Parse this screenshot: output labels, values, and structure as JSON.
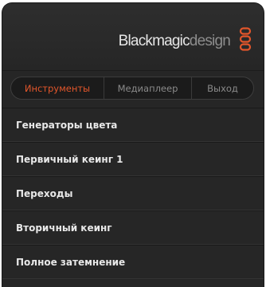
{
  "brand": {
    "name_bold": "Blackmagic",
    "name_light": "design",
    "logo_icon": "blackmagic-logo-icon",
    "accent_color": "#e2562b"
  },
  "tabs": [
    {
      "label": "Инструменты",
      "active": true
    },
    {
      "label": "Медиаплеер",
      "active": false
    },
    {
      "label": "Выход",
      "active": false
    }
  ],
  "menu": {
    "items": [
      {
        "label": "Генераторы цвета"
      },
      {
        "label": "Первичный кеинг 1"
      },
      {
        "label": "Переходы"
      },
      {
        "label": "Вторичный кеинг"
      },
      {
        "label": "Полное затемнение"
      }
    ]
  }
}
